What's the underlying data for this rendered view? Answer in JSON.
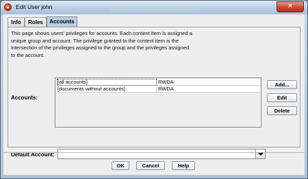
{
  "window": {
    "title": "Edit User john",
    "close_glyph": "✕"
  },
  "tabs": [
    {
      "label": "Info",
      "active": false
    },
    {
      "label": "Roles",
      "active": false
    },
    {
      "label": "Accounts",
      "active": true
    }
  ],
  "accounts_panel": {
    "description_lines": [
      "This page shows users' privileges for accounts. Each content item is assigned a",
      "unique group and account. The privilege granted to the content item is the",
      "intersection of the privileges assigned to the group and the privileges assigned",
      "to the account."
    ],
    "accounts_label": "Accounts:",
    "rows": [
      {
        "account": "[all accounts]",
        "privileges": "RWDA",
        "selected": true
      },
      {
        "account": "[documents without accounts]",
        "privileges": "RWDA",
        "selected": false
      }
    ],
    "add_label": "Add...",
    "edit_label": "Edit",
    "delete_label": "Delete",
    "default_account_label": "Default Account:",
    "default_account_value": ""
  },
  "footer": {
    "ok_label": "OK",
    "cancel_label": "Cancel",
    "help_label": "Help"
  },
  "colors": {
    "active_tab": "#b8cfe5",
    "close_button": "#c64a33"
  }
}
